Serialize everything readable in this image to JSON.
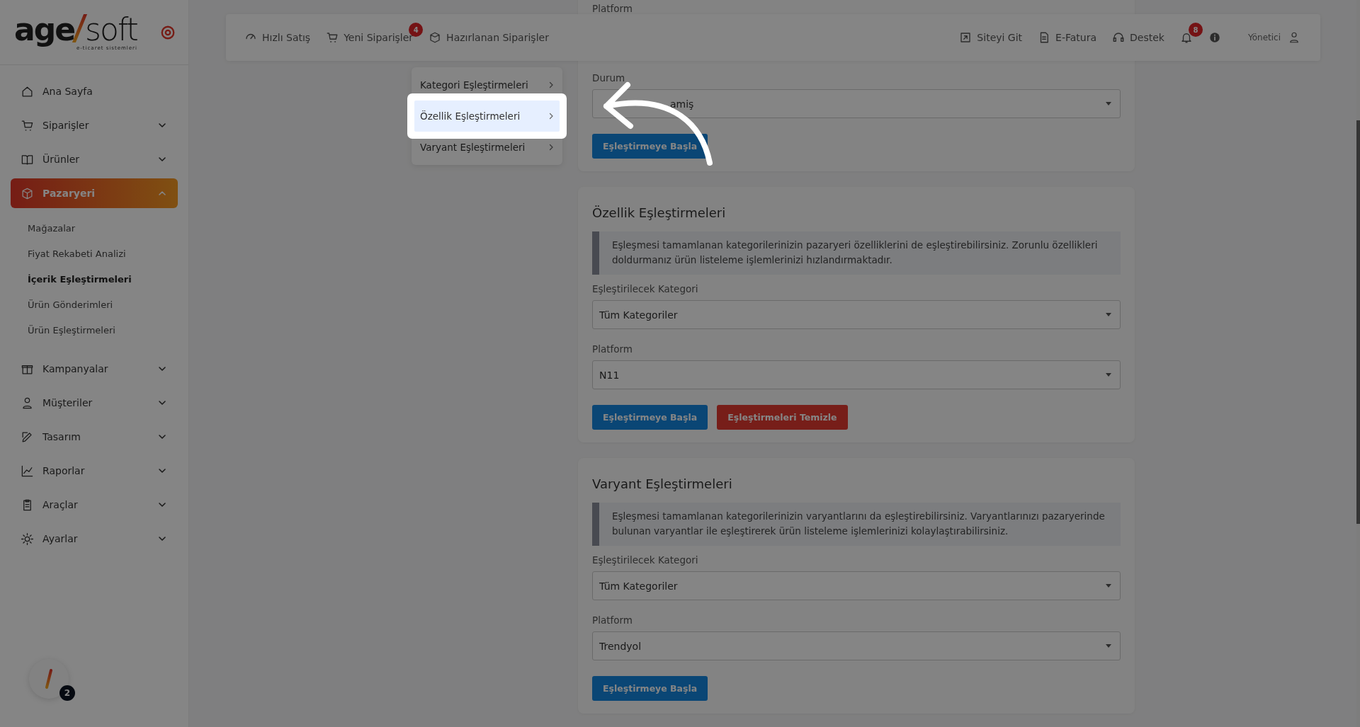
{
  "sidebar": {
    "logo": {
      "bold": "age",
      "light": "soft",
      "tagline": "e-ticaret sistemleri"
    },
    "items": [
      {
        "label": "Ana Sayfa",
        "kind": "link",
        "selected": false
      },
      {
        "label": "Siparişler",
        "kind": "group",
        "expanded": false,
        "selected": false
      },
      {
        "label": "Ürünler",
        "kind": "group",
        "expanded": false,
        "selected": false
      },
      {
        "label": "Pazaryeri",
        "kind": "group",
        "expanded": true,
        "selected": true,
        "children": [
          {
            "label": "Mağazalar",
            "selected": false
          },
          {
            "label": "Fiyat Rekabeti Analizi",
            "selected": false
          },
          {
            "label": "İçerik Eşleştirmeleri",
            "selected": true
          },
          {
            "label": "Ürün Gönderimleri",
            "selected": false
          },
          {
            "label": "Ürün Eşleştirmeleri",
            "selected": false
          }
        ]
      },
      {
        "label": "Kampanyalar",
        "kind": "group",
        "expanded": false,
        "selected": false
      },
      {
        "label": "Müşteriler",
        "kind": "group",
        "expanded": false,
        "selected": false
      },
      {
        "label": "Tasarım",
        "kind": "group",
        "expanded": false,
        "selected": false
      },
      {
        "label": "Raporlar",
        "kind": "group",
        "expanded": false,
        "selected": false
      },
      {
        "label": "Araçlar",
        "kind": "group",
        "expanded": false,
        "selected": false
      },
      {
        "label": "Ayarlar",
        "kind": "group",
        "expanded": false,
        "selected": false
      }
    ],
    "help_widget": {
      "badge": "2"
    }
  },
  "top_bar": {
    "left_links": [
      {
        "label": "Hızlı Satış"
      },
      {
        "label": "Yeni Siparişler",
        "badge": "4"
      },
      {
        "label": "Hazırlanan Siparişler"
      }
    ],
    "right_links": [
      {
        "label": "Siteyi Git"
      },
      {
        "label": "E-Fatura"
      },
      {
        "label": "Destek"
      }
    ],
    "notifications_badge": "8",
    "user": "Yönetici"
  },
  "submenu": {
    "items": [
      {
        "label": "Kategori Eşleştirmeleri",
        "selected": false
      },
      {
        "label": "Özellik Eşleştirmeleri",
        "selected": true
      },
      {
        "label": "Varyant Eşleştirmeleri",
        "selected": false
      }
    ]
  },
  "cards": [
    {
      "fields": [
        {
          "label": "Platform"
        },
        {
          "label": "Durum",
          "value": "amiş"
        }
      ],
      "buttons": [
        {
          "label": "Eşleştirmeye Başla",
          "kind": "primary"
        }
      ]
    },
    {
      "title": "Özellik Eşleştirmeleri",
      "info": "Eşleşmesi tamamlanan kategorilerinizin pazaryeri özelliklerini de eşleştirebilirsiniz. Zorunlu özellikleri doldurmanız ürün listeleme işlemlerinizi hızlandırmaktadır.",
      "fields": [
        {
          "label": "Eşleştirilecek Kategori",
          "value": "Tüm Kategoriler"
        },
        {
          "label": "Platform",
          "value": "N11"
        }
      ],
      "buttons": [
        {
          "label": "Eşleştirmeye Başla",
          "kind": "primary"
        },
        {
          "label": "Eşleştirmeleri Temizle",
          "kind": "danger"
        }
      ]
    },
    {
      "title": "Varyant Eşleştirmeleri",
      "info": "Eşleşmesi tamamlanan kategorilerinizin varyantlarını da eşleştirebilirsiniz. Varyantlarınızı pazaryerinde bulunan varyantlar ile eşleştirerek ürün listeleme işlemlerinizi kolaylaştırabilirsiniz.",
      "fields": [
        {
          "label": "Eşleştirilecek Kategori",
          "value": "Tüm Kategoriler"
        },
        {
          "label": "Platform",
          "value": "Trendyol"
        }
      ],
      "buttons": [
        {
          "label": "Eşleştirmeye Başla",
          "kind": "primary"
        }
      ]
    }
  ]
}
